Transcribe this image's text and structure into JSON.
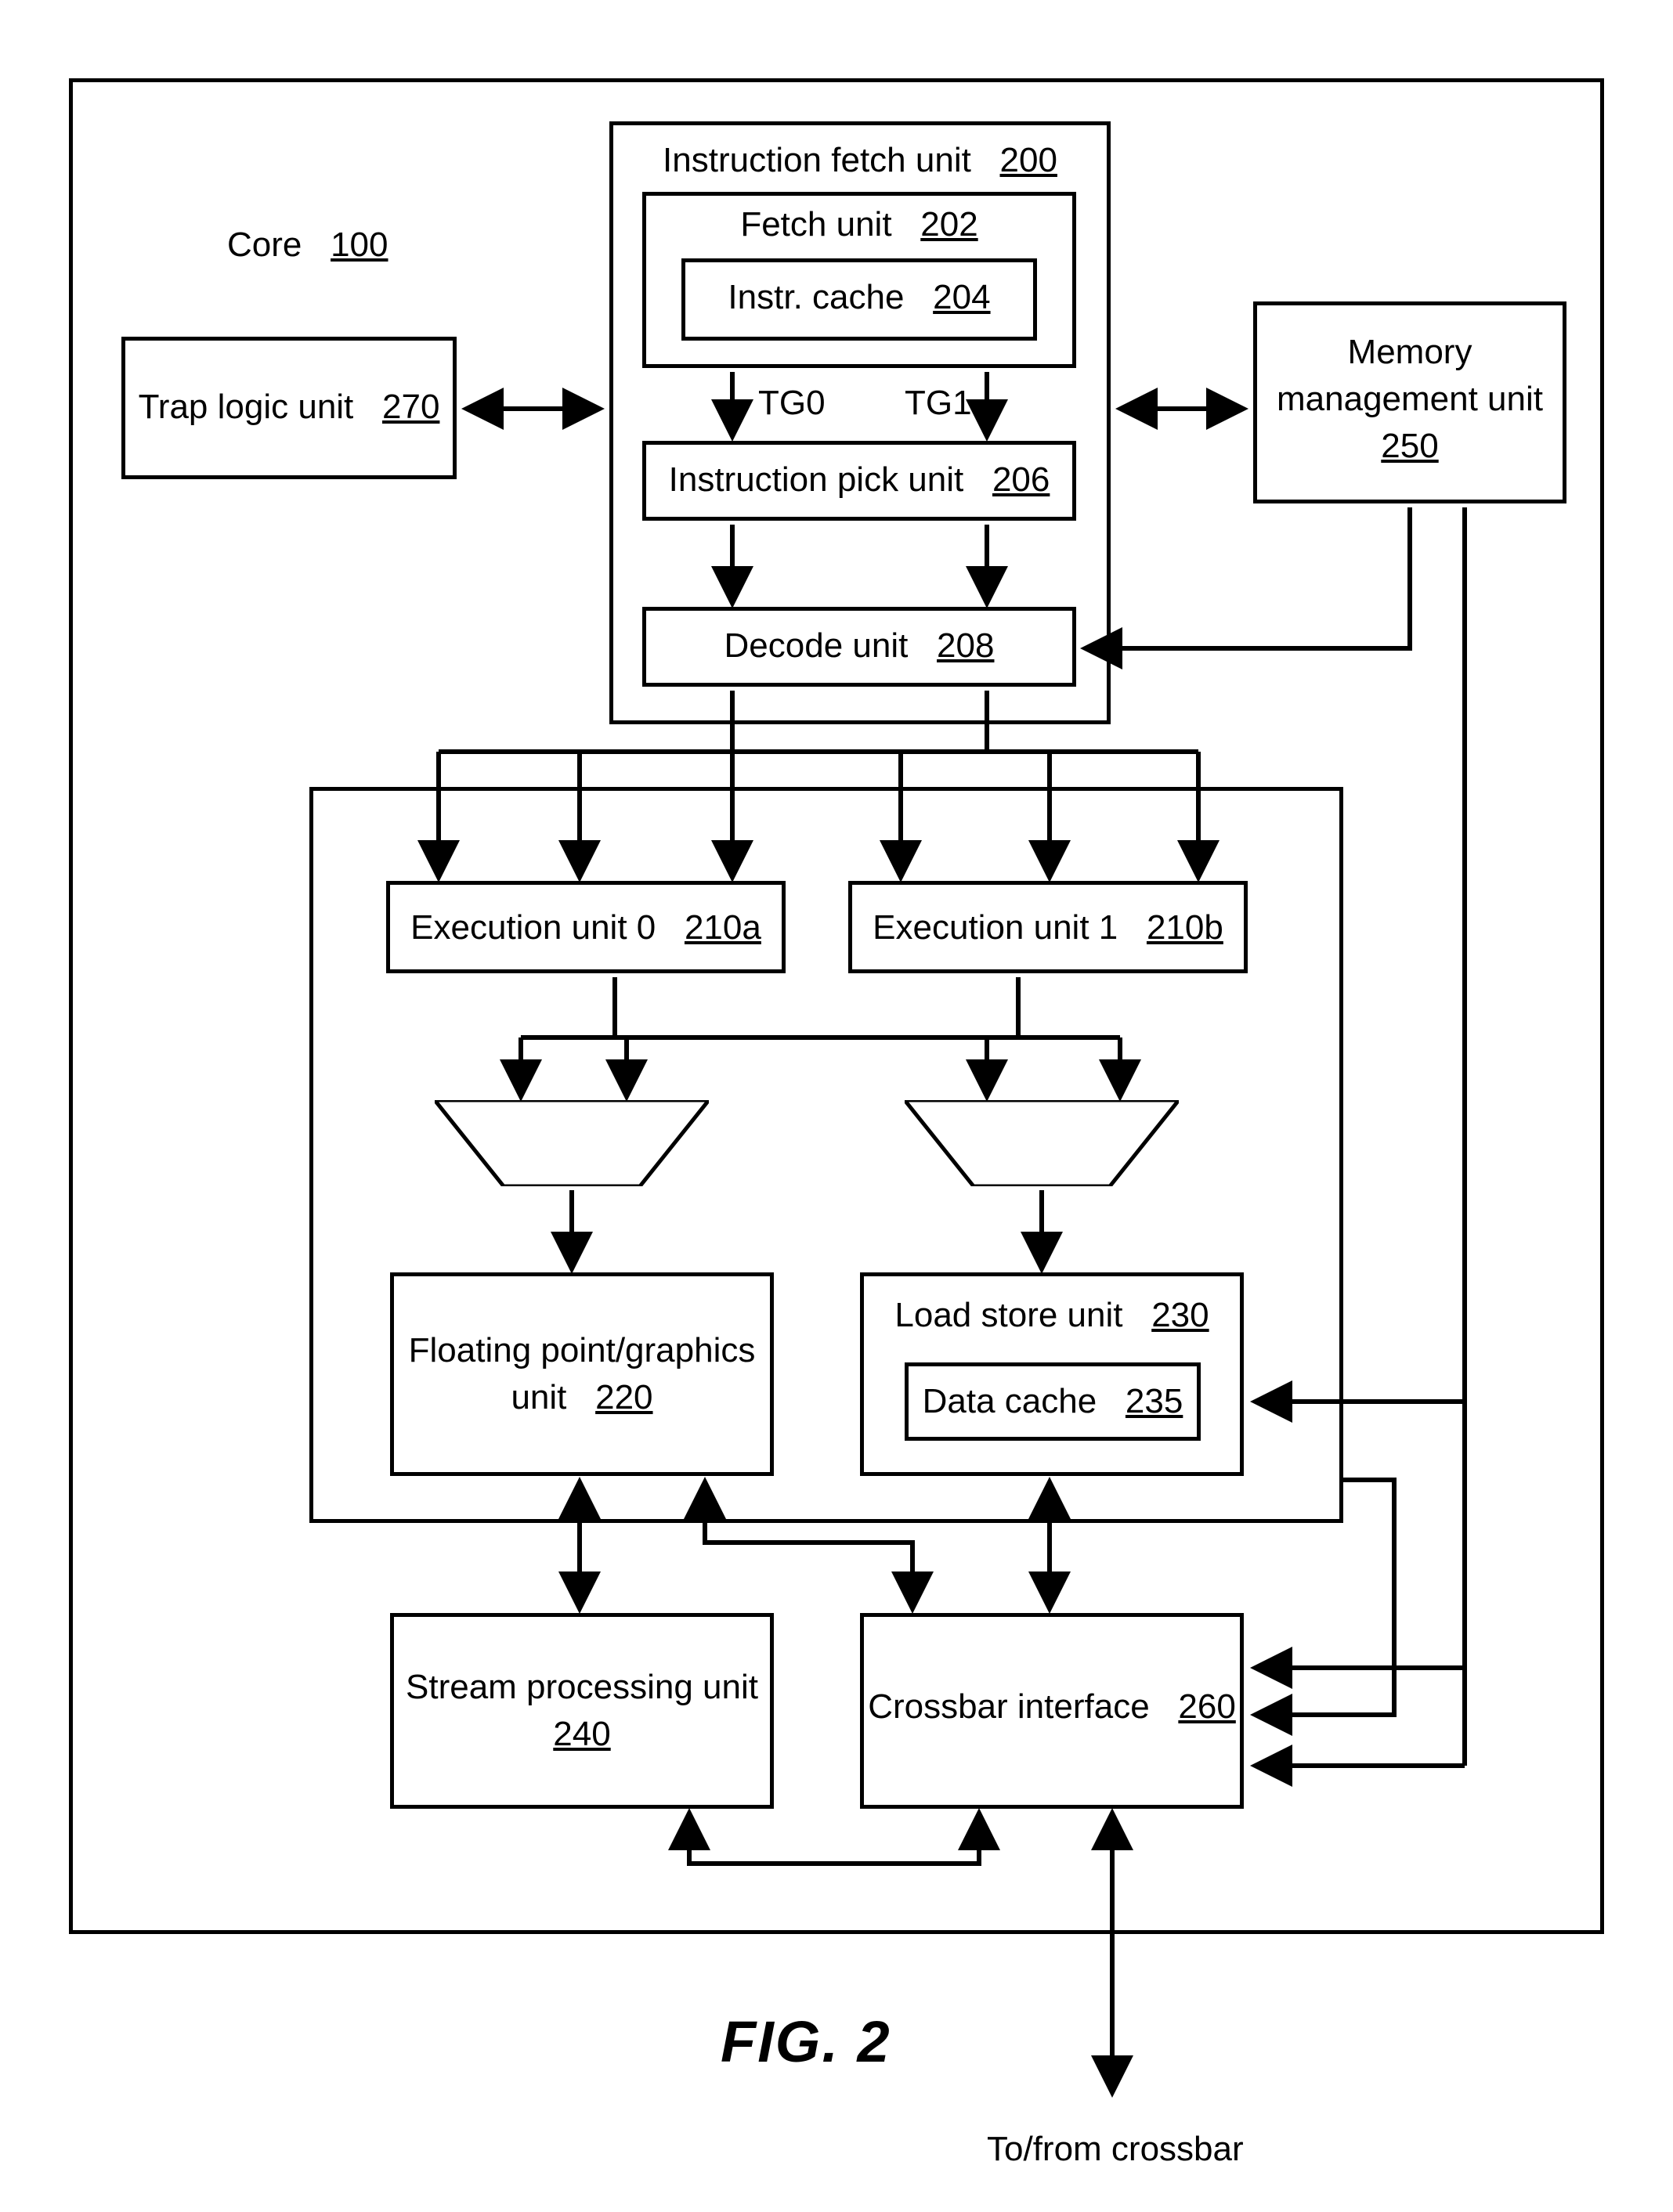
{
  "core": {
    "label": "Core",
    "ref": "100"
  },
  "trap_logic": {
    "label": "Trap logic unit",
    "ref": "270"
  },
  "ifu": {
    "title": "Instruction fetch unit",
    "title_ref": "200",
    "fetch": {
      "label": "Fetch unit",
      "ref": "202"
    },
    "icache": {
      "label": "Instr. cache",
      "ref": "204"
    },
    "tg0": "TG0",
    "tg1": "TG1",
    "pick": {
      "label": "Instruction pick unit",
      "ref": "206"
    },
    "decode": {
      "label": "Decode unit",
      "ref": "208"
    }
  },
  "mmu": {
    "line1": "Memory",
    "line2": "management unit",
    "ref": "250"
  },
  "exu0": {
    "label": "Execution unit 0",
    "ref": "210a"
  },
  "exu1": {
    "label": "Execution unit 1",
    "ref": "210b"
  },
  "fgu": {
    "line1": "Floating point/graphics",
    "line2": "unit",
    "ref": "220"
  },
  "lsu": {
    "label": "Load store unit",
    "ref": "230",
    "dcache_label": "Data cache",
    "dcache_ref": "235"
  },
  "spu": {
    "line1": "Stream processing unit",
    "ref": "240"
  },
  "xbar": {
    "label": "Crossbar interface",
    "ref": "260"
  },
  "footer": "To/from crossbar",
  "figure": "FIG. 2"
}
